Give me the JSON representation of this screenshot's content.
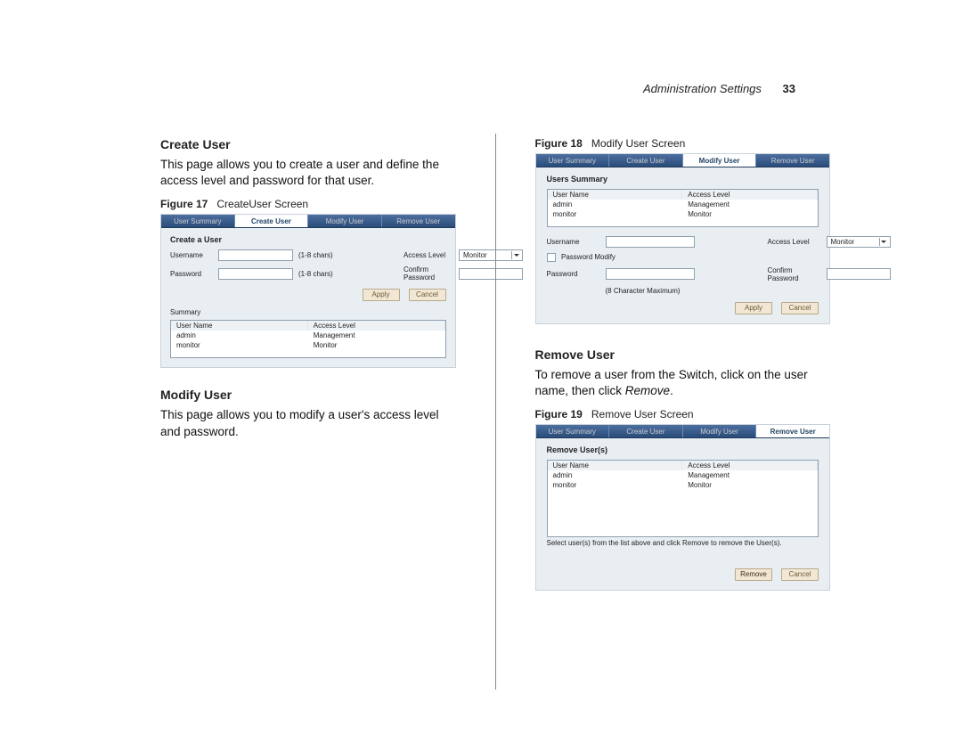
{
  "header": {
    "section": "Administration Settings",
    "page_number": "33"
  },
  "left": {
    "h_create": "Create User",
    "p_create": "This page allows you to create a user and define the access level and password for that user.",
    "fig17_label": "Figure 17",
    "fig17_title": "CreateUser Screen",
    "h_modify": "Modify User",
    "p_modify": "This page allows you to modify a user's access level and password."
  },
  "right": {
    "fig18_label": "Figure 18",
    "fig18_title": "Modify User Screen",
    "h_remove": "Remove User",
    "p_remove_1": "To remove a user from the Switch, click on the user name, then click ",
    "p_remove_em": "Remove",
    "p_remove_2": ".",
    "fig19_label": "Figure 19",
    "fig19_title": "Remove User Screen"
  },
  "common": {
    "tabs": [
      "User Summary",
      "Create User",
      "Modify User",
      "Remove User"
    ],
    "users": [
      {
        "name": "admin",
        "level": "Management"
      },
      {
        "name": "monitor",
        "level": "Monitor"
      }
    ],
    "th_user": "User Name",
    "th_level": "Access Level",
    "btn_apply": "Apply",
    "btn_cancel": "Cancel",
    "btn_remove": "Remove"
  },
  "fig17": {
    "active_tab": 1,
    "section_title": "Create a User",
    "lbl_username": "Username",
    "hint_username": "(1-8 chars)",
    "lbl_access": "Access Level",
    "sel_access_value": "Monitor",
    "lbl_password": "Password",
    "hint_password": "(1-8 chars)",
    "lbl_confirm": "Confirm Password",
    "summary_title": "Summary"
  },
  "fig18": {
    "active_tab": 2,
    "section_title": "Users Summary",
    "lbl_username": "Username",
    "lbl_access": "Access Level",
    "sel_access_value": "Monitor",
    "chk_pw_modify": "Password Modify",
    "lbl_password": "Password",
    "hint_password": "(8 Character Maximum)",
    "lbl_confirm": "Confirm Password"
  },
  "fig19": {
    "active_tab": 3,
    "section_title": "Remove User(s)",
    "note": "Select user(s) from the list above and click Remove to remove the User(s)."
  }
}
